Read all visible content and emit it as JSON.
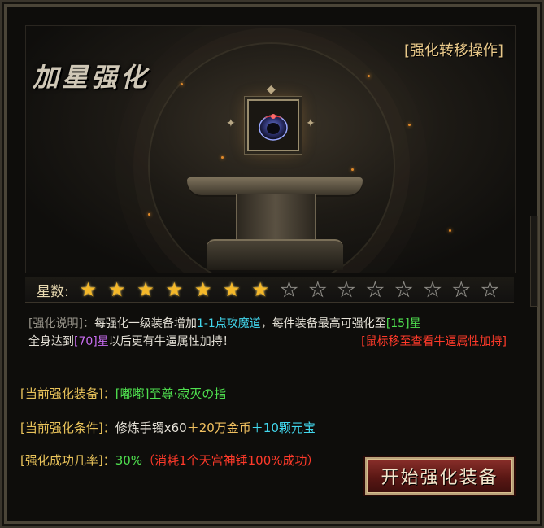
{
  "panel": {
    "title": "加星强化",
    "transfer_link": "[强化转移操作]"
  },
  "item": {
    "icon": "dark-ring-icon"
  },
  "stars": {
    "label": "星数:",
    "filled": 7,
    "total": 15
  },
  "description": {
    "prefix": "[强化说明]：",
    "text1": "每强化一级装备增加",
    "highlight1": "1-1点攻魔道",
    "text2": "，每件装备最高可强化至",
    "max_level": "[15]",
    "star_char": "星",
    "line2_a": "全身达到",
    "total_stars": "[70]",
    "star_char2": "星",
    "line2_b": "以后更有牛逼属性加持！",
    "hover_hint": "[鼠标移至查看牛逼属性加持]"
  },
  "current_equipment": {
    "label": "[当前强化装备]：",
    "value": "[嘟嘟]至尊·寂灭の指"
  },
  "current_conditions": {
    "label": "[当前强化条件]：",
    "material": "修炼手镯x60",
    "gold": "＋20万金币",
    "yuanbao": "＋10颗元宝"
  },
  "success_rate": {
    "label": "[强化成功几率]：",
    "value": "30%",
    "note": "（消耗1个天宫神锤100%成功）"
  },
  "actions": {
    "start_label": "开始强化装备"
  },
  "colors": {
    "cyan": "#42d8ee",
    "green": "#4fe04f",
    "purple": "#c86cf0",
    "red": "#ff3a2a",
    "gold_star": "#f4b82a"
  }
}
